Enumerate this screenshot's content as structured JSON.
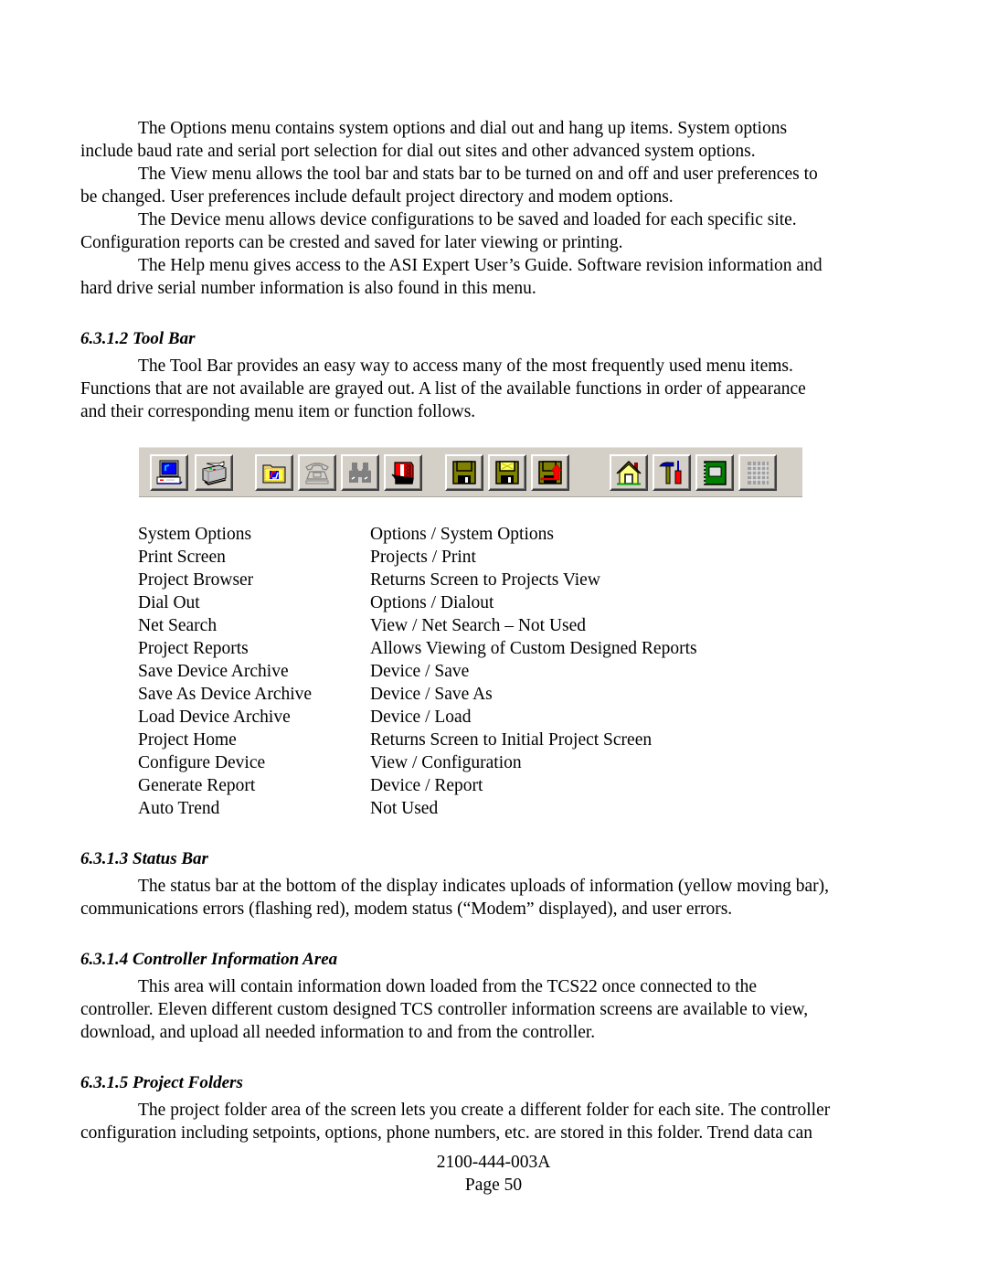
{
  "paragraphs_intro": [
    {
      "first": "The Options menu contains system options and dial out and hang up items. System options",
      "rest": "include baud rate and serial port selection for dial out sites and other advanced system options."
    },
    {
      "first": "The View menu allows the tool bar and stats bar to be turned on and off and user preferences to",
      "rest": "be changed. User preferences include default project directory and modem options."
    },
    {
      "first": "The Device menu allows device configurations to be saved and loaded for each specific site.",
      "rest": "Configuration reports can be crested and saved for later viewing or printing."
    },
    {
      "first": "The Help menu gives access to the ASI Expert User’s Guide. Software revision information and",
      "rest": "hard drive serial number information is also found in this menu."
    }
  ],
  "sections": {
    "tool_bar": {
      "heading": "6.3.1.2 Tool Bar",
      "lines": [
        "The Tool Bar provides an easy way to access many of the most frequently used menu items.",
        "Functions that are not available are grayed out. A list of the available functions in order of appearance",
        "and their corresponding menu item or function follows."
      ]
    },
    "status_bar": {
      "heading": "6.3.1.3 Status Bar",
      "lines": [
        "The status bar at the bottom of the display indicates uploads of information (yellow moving bar),",
        "communications errors (flashing red), modem status (“Modem” displayed), and user errors."
      ]
    },
    "controller_info": {
      "heading": "6.3.1.4 Controller Information Area",
      "lines": [
        "This area will contain information down loaded from the TCS22 once connected to the",
        "controller. Eleven different custom designed TCS controller information screens are available to view,",
        "download, and upload all needed information to and from the controller."
      ]
    },
    "project_folders": {
      "heading": "6.3.1.5 Project Folders",
      "lines": [
        "The project folder area of the screen lets you create a different folder for each site. The controller",
        "configuration including setpoints, options, phone numbers, etc. are stored in this folder. Trend data can"
      ]
    }
  },
  "toolbar": {
    "buttons": [
      {
        "icon": "computer-monitor-icon",
        "label": "System Options",
        "enabled": true
      },
      {
        "icon": "printer-icon",
        "label": "Print Screen",
        "enabled": true
      },
      {
        "icon": "project-folder-icon",
        "label": "Project Browser",
        "enabled": true
      },
      {
        "icon": "telephone-icon",
        "label": "Dial Out",
        "enabled": false
      },
      {
        "icon": "binoculars-icon",
        "label": "Net Search",
        "enabled": false
      },
      {
        "icon": "report-book-icon",
        "label": "Project Reports",
        "enabled": true
      },
      {
        "icon": "floppy-disk-icon",
        "label": "Save Device Archive",
        "enabled": true
      },
      {
        "icon": "floppy-disk-save-as-icon",
        "label": "Save As Device Archive",
        "enabled": true
      },
      {
        "icon": "floppy-disk-load-icon",
        "label": "Load Device Archive",
        "enabled": true
      },
      {
        "icon": "house-icon",
        "label": "Project Home",
        "enabled": true
      },
      {
        "icon": "hammer-screwdriver-icon",
        "label": "Configure Device",
        "enabled": true
      },
      {
        "icon": "green-notebook-icon",
        "label": "Generate Report",
        "enabled": true
      },
      {
        "icon": "grid-trend-icon",
        "label": "Auto Trend",
        "enabled": false
      }
    ]
  },
  "function_table": [
    {
      "function": "System Options",
      "menu": "Options / System Options"
    },
    {
      "function": "Print Screen",
      "menu": "Projects / Print"
    },
    {
      "function": "Project Browser",
      "menu": "Returns Screen to Projects View"
    },
    {
      "function": "Dial Out",
      "menu": "Options / Dialout"
    },
    {
      "function": "Net Search",
      "menu": "View / Net Search – Not Used"
    },
    {
      "function": "Project Reports",
      "menu": "Allows Viewing of Custom Designed Reports"
    },
    {
      "function": "Save Device Archive",
      "menu": "Device / Save"
    },
    {
      "function": "Save As Device Archive",
      "menu": "Device / Save As"
    },
    {
      "function": "Load Device Archive",
      "menu": "Device / Load"
    },
    {
      "function": "Project Home",
      "menu": "Returns Screen to Initial Project Screen"
    },
    {
      "function": "Configure Device",
      "menu": "View / Configuration"
    },
    {
      "function": "Generate Report",
      "menu": "Device / Report"
    },
    {
      "function": "Auto Trend",
      "menu": "Not Used"
    }
  ],
  "footer": {
    "doc_number": "2100-444-003A",
    "page": "Page 50"
  }
}
